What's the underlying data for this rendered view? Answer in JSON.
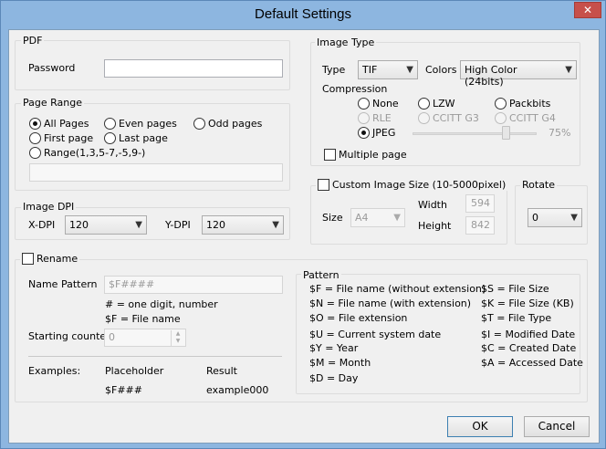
{
  "window": {
    "title": "Default Settings",
    "close_label": "✕"
  },
  "pdf": {
    "label": "PDF",
    "password_label": "Password",
    "password_value": ""
  },
  "page_range": {
    "label": "Page Range",
    "options": [
      "All Pages",
      "Even pages",
      "Odd pages",
      "First page",
      "Last page",
      "Range(1,3,5-7,-5,9-)"
    ],
    "selected": "All Pages",
    "range_value": ""
  },
  "image_dpi": {
    "label": "Image DPI",
    "x_label": "X-DPI",
    "x_value": "120",
    "y_label": "Y-DPI",
    "y_value": "120"
  },
  "image_type": {
    "label": "Image Type",
    "type_label": "Type",
    "type_value": "TIF",
    "colors_label": "Colors",
    "colors_value": "High Color (24bits)",
    "compression_label": "Compression",
    "compression_options": [
      "None",
      "LZW",
      "Packbits",
      "RLE",
      "CCITT G3",
      "CCITT G4",
      "JPEG"
    ],
    "compression_selected": "JPEG",
    "quality_value": "75%",
    "quality_fraction": 0.75,
    "multiple_page_label": "Multiple page"
  },
  "custom_size": {
    "label": "Custom Image Size (10-5000pixel)",
    "size_label": "Size",
    "size_value": "A4",
    "width_label": "Width",
    "width_value": "594",
    "height_label": "Height",
    "height_value": "842"
  },
  "rotate": {
    "label": "Rotate",
    "value": "0"
  },
  "rename": {
    "label": "Rename",
    "name_pattern_label": "Name Pattern",
    "name_pattern_value": "$F####",
    "hint1": "# = one digit, number",
    "hint2": "$F = File name",
    "starting_counter_label": "Starting counter",
    "starting_counter_value": "0",
    "examples_label": "Examples:",
    "placeholder_header": "Placeholder",
    "result_header": "Result",
    "placeholder_value": "$F###",
    "result_value": "example000"
  },
  "pattern": {
    "label": "Pattern",
    "left": [
      "$F = File name (without extension)",
      "$N = File name (with extension)",
      "$O = File extension",
      "$U = Current system date",
      "$Y = Year",
      "$M = Month",
      "$D = Day"
    ],
    "right": [
      "$S = File Size",
      "$K = File Size (KB)",
      "$T = File Type",
      "$I = Modified Date",
      "$C = Created Date",
      "$A = Accessed Date"
    ]
  },
  "buttons": {
    "ok": "OK",
    "cancel": "Cancel"
  }
}
